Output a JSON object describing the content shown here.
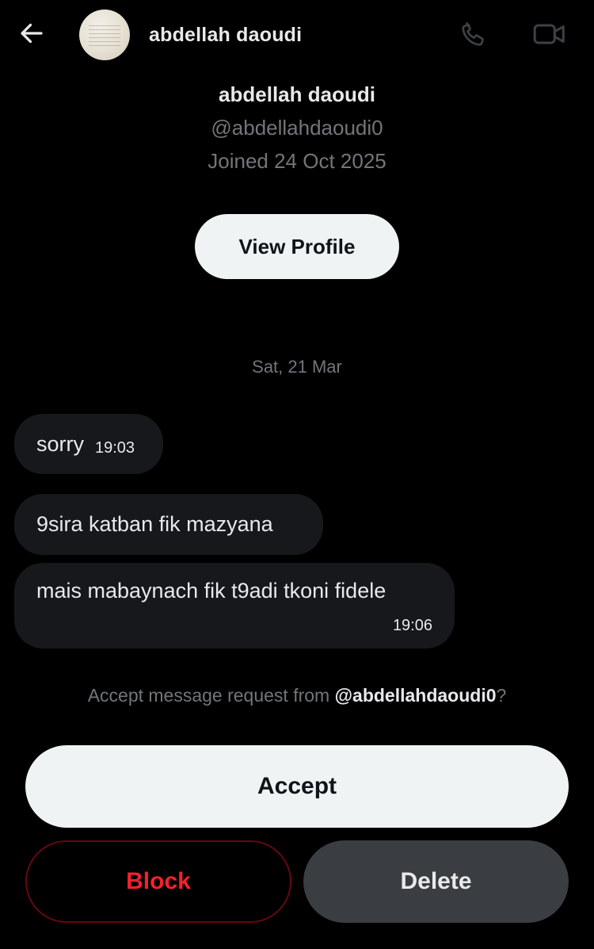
{
  "colors": {
    "background": "#000000",
    "primary_text": "#e7e9ea",
    "secondary_text": "#71767b",
    "bubble": "#16181c",
    "light_button": "#eff3f4",
    "danger": "#f4212e",
    "delete_button": "#3a3d41"
  },
  "header": {
    "back_icon": "arrow-left-icon",
    "name": "abdellah daoudi",
    "call_icon": "phone-icon",
    "video_icon": "video-camera-icon"
  },
  "profile": {
    "name": "abdellah daoudi",
    "handle": "@abdellahdaoudi0",
    "joined": "Joined 24 Oct 2025",
    "view_profile_label": "View Profile"
  },
  "conversation": {
    "date_label": "Sat, 21 Mar",
    "messages": [
      {
        "text": "sorry",
        "time": "19:03"
      },
      {
        "text": "9sira katban fik mazyana",
        "time": ""
      },
      {
        "text": "mais mabaynach fik t9adi tkoni fidele",
        "time": "19:06"
      }
    ]
  },
  "request": {
    "prefix": "Accept message request from ",
    "handle": "@abdellahdaoudi0",
    "suffix": "?",
    "accept_label": "Accept",
    "block_label": "Block",
    "delete_label": "Delete"
  }
}
